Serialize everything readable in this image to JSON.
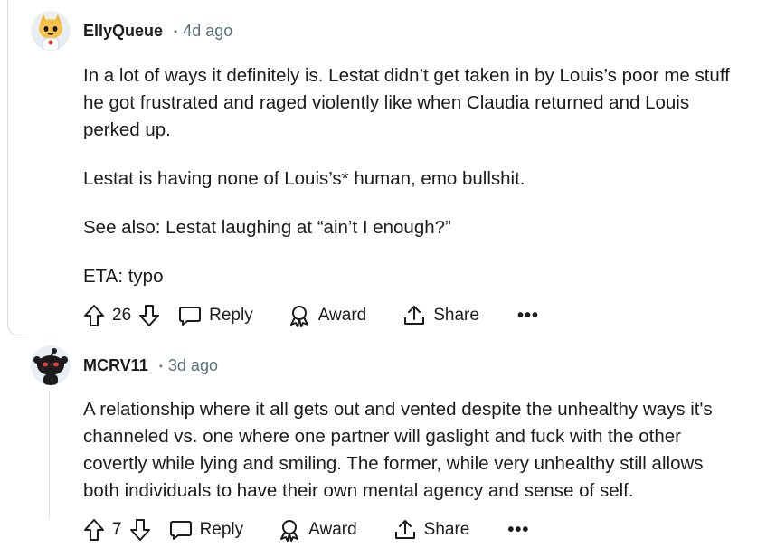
{
  "comments": [
    {
      "author": "EllyQueue",
      "time": "4d ago",
      "paragraphs": [
        "In a lot of ways it definitely is. Lestat didn’t get taken in by Louis’s poor me stuff he got frustrated and raged violently like when Claudia returned and Louis perked up.",
        "Lestat is having none of Louis’s* human, emo bullshit.",
        "See also: Lestat laughing at “ain’t I enough?”",
        "ETA: typo"
      ],
      "votes": "26",
      "reply_label": "Reply",
      "award_label": "Award",
      "share_label": "Share",
      "more_label": "•••",
      "avatar_icon": "cat-snoo-avatar-icon"
    },
    {
      "author": "MCRV11",
      "time": "3d ago",
      "paragraphs": [
        "A relationship where it all gets out and vented despite the unhealthy ways it's channeled vs. one where one partner will gaslight and fuck with the other covertly while lying and smiling. The former, while very unhealthy still allows both individuals to have their own mental agency and sense of self."
      ],
      "votes": "7",
      "reply_label": "Reply",
      "award_label": "Award",
      "share_label": "Share",
      "more_label": "•••",
      "avatar_icon": "dark-snoo-avatar-icon"
    }
  ],
  "colors": {
    "meta_gray": "#576f76",
    "thread_line": "#d7dadc",
    "text": "#1c1c1c"
  }
}
